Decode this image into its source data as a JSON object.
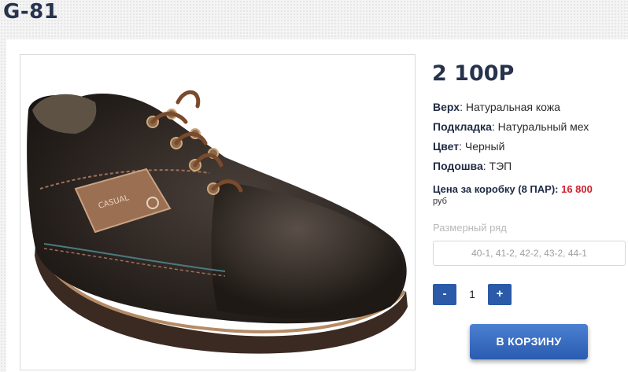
{
  "product": {
    "title": "G-81",
    "price": "2 100Р"
  },
  "specs": [
    {
      "label": "Верх",
      "value": "Натуральная кожа"
    },
    {
      "label": "Подкладка",
      "value": "Натуральный мех"
    },
    {
      "label": "Цвет",
      "value": "Черный"
    },
    {
      "label": "Подошва",
      "value": "ТЭП"
    }
  ],
  "box_price": {
    "label": "Цена за коробку (8 ПАР):",
    "value": "16 800",
    "currency": "руб"
  },
  "sizes": {
    "label": "Размерный ряд",
    "value": "40-1, 41-2, 42-2, 43-2, 44-1"
  },
  "quantity": {
    "minus_label": "-",
    "value": "1",
    "plus_label": "+"
  },
  "cart_button_label": "В КОРЗИНУ",
  "image": {
    "patch_text": "CASUAL"
  },
  "colors": {
    "title": "#27324d",
    "accent": "#2a5aa8",
    "price_red": "#d0202d"
  }
}
